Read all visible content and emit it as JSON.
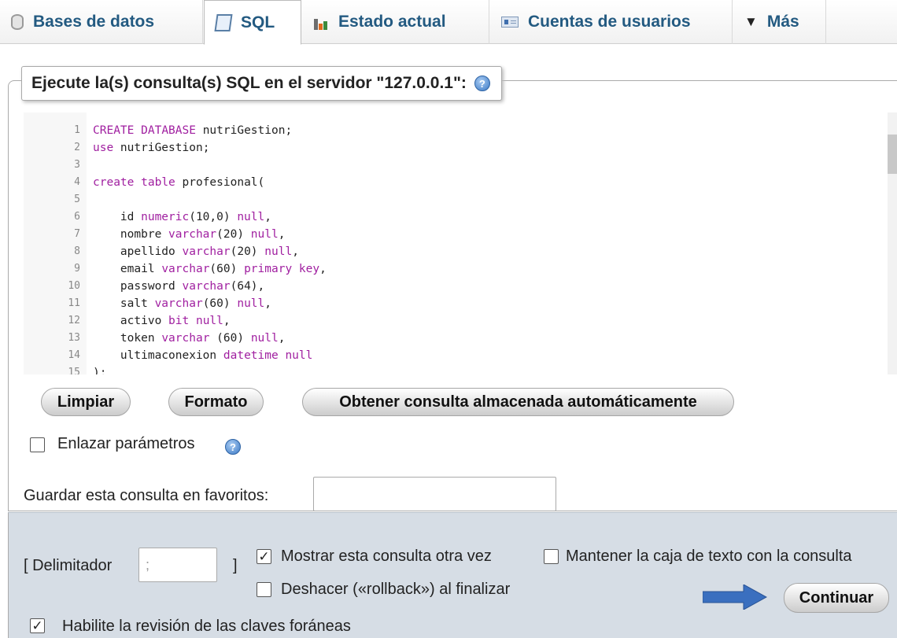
{
  "tabs": [
    {
      "label": "Bases de datos",
      "icon": "database-icon"
    },
    {
      "label": "SQL",
      "icon": "sql-icon",
      "active": true
    },
    {
      "label": "Estado actual",
      "icon": "status-chart-icon"
    },
    {
      "label": "Cuentas de usuarios",
      "icon": "users-icon"
    },
    {
      "label": "Más",
      "icon": "triangle-down-icon"
    }
  ],
  "query_panel": {
    "legend": "Ejecute la(s) consulta(s) SQL en el servidor \"127.0.0.1\":",
    "editor": {
      "lines": [
        {
          "n": "1",
          "text": "CREATE DATABASE nutriGestion;"
        },
        {
          "n": "2",
          "text": "use nutriGestion;"
        },
        {
          "n": "3",
          "text": ""
        },
        {
          "n": "4",
          "text": "create table profesional("
        },
        {
          "n": "5",
          "text": ""
        },
        {
          "n": "6",
          "text": "    id numeric(10,0) null,"
        },
        {
          "n": "7",
          "text": "    nombre varchar(20) null,"
        },
        {
          "n": "8",
          "text": "    apellido varchar(20) null,"
        },
        {
          "n": "9",
          "text": "    email varchar(60) primary key,"
        },
        {
          "n": "10",
          "text": "    password varchar(64),"
        },
        {
          "n": "11",
          "text": "    salt varchar(60) null,"
        },
        {
          "n": "12",
          "text": "    activo bit null,"
        },
        {
          "n": "13",
          "text": "    token varchar (60) null,"
        },
        {
          "n": "14",
          "text": "    ultimaconexion datetime null"
        },
        {
          "n": "15",
          "text": ");"
        }
      ]
    },
    "buttons": {
      "clear": "Limpiar",
      "format": "Formato",
      "autosaved": "Obtener consulta almacenada automáticamente"
    },
    "bind_params_label": "Enlazar parámetros",
    "bind_params_checked": false,
    "bookmark_label": "Guardar esta consulta en favoritos:",
    "bookmark_value": ""
  },
  "footer": {
    "delimiter_label_open": "[ Delimitador",
    "delimiter_value": ";",
    "delimiter_label_close": "]",
    "show_query_again": {
      "label": "Mostrar esta consulta otra vez",
      "checked": true
    },
    "retain_query_box": {
      "label": "Mantener la caja de texto con la consulta",
      "checked": false
    },
    "rollback": {
      "label": "Deshacer («rollback») al finalizar",
      "checked": false
    },
    "foreign_keys": {
      "label": "Habilite la revisión de las claves foráneas",
      "checked": true
    },
    "submit_label": "Continuar",
    "arrow_color": "#3a6fbf"
  }
}
